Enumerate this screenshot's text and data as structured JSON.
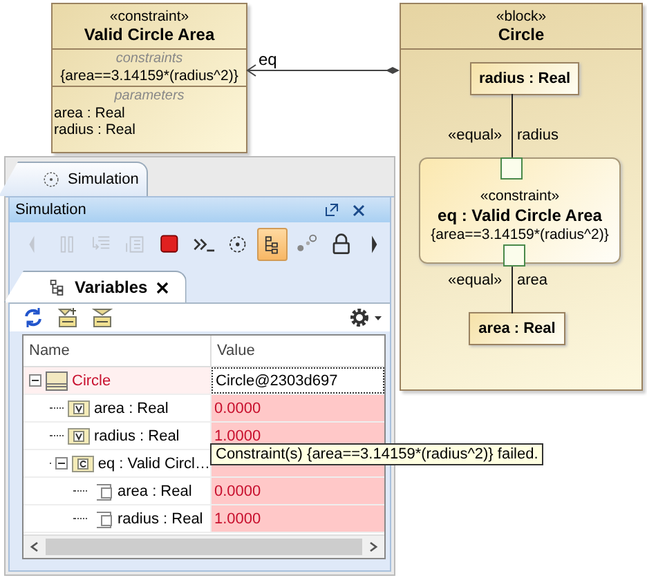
{
  "diagram": {
    "constraint_block": {
      "stereotype": "«constraint»",
      "name": "Valid Circle Area",
      "constraints_heading": "constraints",
      "constraint": "{area==3.14159*(radius^2)}",
      "parameters_heading": "parameters",
      "parameters": [
        "area : Real",
        "radius : Real"
      ]
    },
    "connector": {
      "label": "eq"
    },
    "block": {
      "stereotype": "«block»",
      "name": "Circle",
      "radius_part": "radius : Real",
      "constraint_property": {
        "stereotype": "«constraint»",
        "name": "eq : Valid Circle Area",
        "constraint": "{area==3.14159*(radius^2)}"
      },
      "area_part": "area : Real",
      "bindings": [
        {
          "stereotype": "«equal»",
          "label": "radius"
        },
        {
          "stereotype": "«equal»",
          "label": "area"
        }
      ]
    }
  },
  "panel": {
    "tab": {
      "label": "Simulation",
      "selected": true
    },
    "title": "Simulation",
    "toolbar": [
      {
        "kind": "prev",
        "disabled": true,
        "selected": false
      },
      {
        "kind": "pause",
        "disabled": true,
        "selected": false
      },
      {
        "kind": "step-into",
        "disabled": true,
        "selected": false
      },
      {
        "kind": "step-out",
        "disabled": true,
        "selected": false
      },
      {
        "kind": "stop",
        "disabled": false,
        "selected": false
      },
      {
        "kind": "console",
        "disabled": false,
        "selected": false
      },
      {
        "kind": "sun",
        "disabled": false,
        "selected": false
      },
      {
        "kind": "tree",
        "disabled": false,
        "selected": true
      },
      {
        "kind": "dots",
        "disabled": false,
        "selected": false
      },
      {
        "kind": "lock",
        "disabled": false,
        "selected": false
      },
      {
        "kind": "next",
        "disabled": false,
        "selected": false
      }
    ],
    "variables_tab": {
      "label": "Variables",
      "selected": true
    },
    "table": {
      "columns": [
        "Name",
        "Value"
      ],
      "rows": [
        {
          "kind": "block",
          "name": "Circle",
          "value": "Circle@2303d697",
          "failed": true,
          "selected": true,
          "expanded": true,
          "children": [
            {
              "kind": "value",
              "name": "area : Real",
              "value": "0.0000",
              "failed": true,
              "selected": false
            },
            {
              "kind": "value",
              "name": "radius : Real",
              "value": "1.0000",
              "failed": true,
              "selected": false
            },
            {
              "kind": "constraint",
              "name": "eq : Valid Circl…",
              "failed": true,
              "selected": false,
              "expanded": true,
              "children": [
                {
                  "kind": "port",
                  "name": "area : Real",
                  "value": "0.0000",
                  "failed": true,
                  "selected": false
                },
                {
                  "kind": "port",
                  "name": "radius : Real",
                  "value": "1.0000",
                  "failed": true,
                  "selected": false
                }
              ]
            }
          ]
        }
      ]
    },
    "tooltip": "Constraint(s) {area==3.14159*(radius^2)} failed."
  }
}
